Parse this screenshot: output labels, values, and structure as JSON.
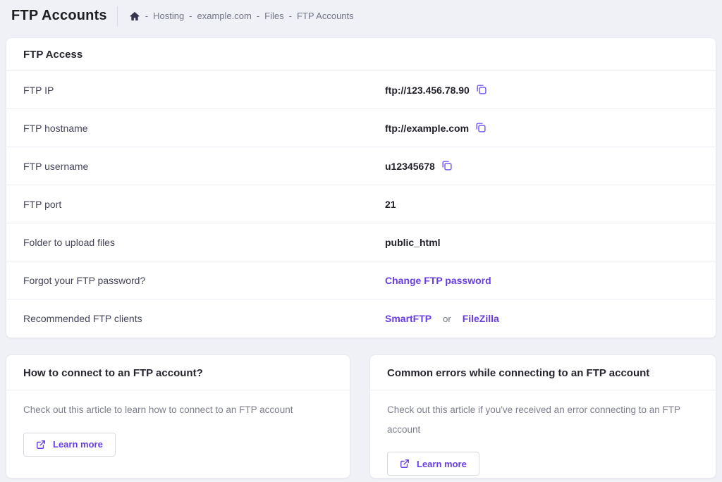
{
  "header": {
    "title": "FTP Accounts",
    "breadcrumb": {
      "separator": "-",
      "items": [
        "Hosting",
        "example.com",
        "Files",
        "FTP Accounts"
      ]
    }
  },
  "ftp_access_card": {
    "title": "FTP Access",
    "rows": [
      {
        "label": "FTP IP",
        "value": "ftp://123.456.78.90",
        "has_copy": true
      },
      {
        "label": "FTP hostname",
        "value": "ftp://example.com",
        "has_copy": true
      },
      {
        "label": "FTP username",
        "value": "u12345678",
        "has_copy": true
      },
      {
        "label": "FTP port",
        "value": "21",
        "has_copy": false
      },
      {
        "label": "Folder to upload files",
        "value": "public_html",
        "has_copy": false
      },
      {
        "label": "Forgot your FTP password?",
        "link": "Change FTP password"
      },
      {
        "label": "Recommended FTP clients",
        "link_1": "SmartFTP",
        "conjunction": "or",
        "link_2": "FileZilla"
      }
    ]
  },
  "info_cards": [
    {
      "title": "How to connect to an FTP account?",
      "body": "Check out this article to learn how to connect to an FTP account",
      "button_label": "Learn more"
    },
    {
      "title": "Common errors while connecting to an FTP account",
      "body": "Check out this article if you've received an error connecting to an FTP account",
      "button_label": "Learn more"
    }
  ],
  "icons": {
    "home": "home-icon",
    "copy": "copy-icon",
    "external_link": "external-link-icon"
  },
  "colors": {
    "accent_purple": "#673de6",
    "copy_icon_purple": "#7b5cf5",
    "page_background": "#f0f1f7",
    "card_background": "#ffffff",
    "muted_text": "#727586",
    "dark_text": "#1f1f28"
  }
}
